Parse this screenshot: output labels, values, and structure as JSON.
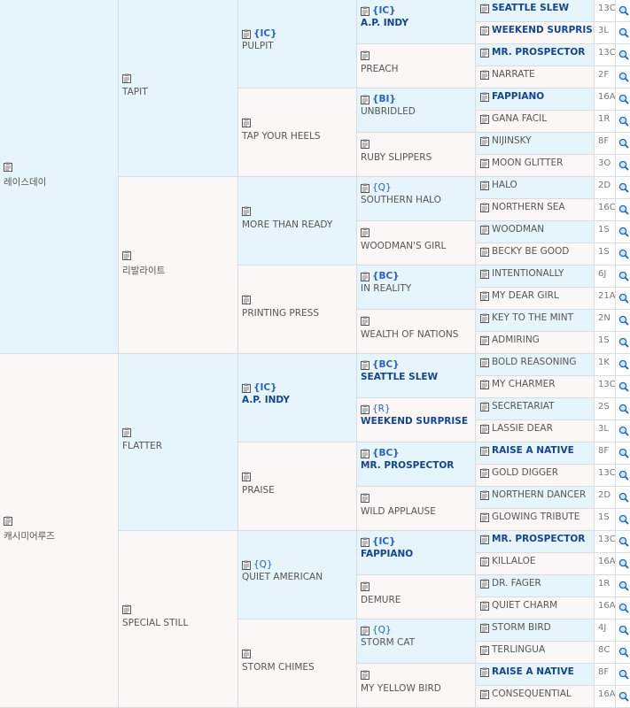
{
  "gen1": [
    {
      "name": "레이스데이",
      "sex": "male"
    },
    {
      "name": "캐시미어루즈",
      "sex": "female"
    }
  ],
  "gen2": [
    {
      "name": "TAPIT",
      "sex": "male"
    },
    {
      "name": "리발라이트",
      "sex": "female"
    },
    {
      "name": "FLATTER",
      "sex": "male"
    },
    {
      "name": "SPECIAL STILL",
      "sex": "female"
    }
  ],
  "gen3": [
    {
      "name": "PULPIT",
      "tag": "{IC}",
      "sex": "male"
    },
    {
      "name": "TAP YOUR HEELS",
      "sex": "female"
    },
    {
      "name": "MORE THAN READY",
      "sex": "male"
    },
    {
      "name": "PRINTING PRESS",
      "sex": "female"
    },
    {
      "name": "A.P. INDY",
      "tag": "{IC}",
      "sex": "male",
      "bold": true
    },
    {
      "name": "PRAISE",
      "sex": "female"
    },
    {
      "name": "QUIET AMERICAN",
      "tag": "{Q}",
      "sex": "male"
    },
    {
      "name": "STORM CHIMES",
      "sex": "female"
    }
  ],
  "gen4": [
    {
      "name": "A.P. INDY",
      "tag": "{IC}",
      "sex": "male",
      "bold": true
    },
    {
      "name": "PREACH",
      "sex": "female"
    },
    {
      "name": "UNBRIDLED",
      "tag": "{BI}",
      "sex": "male"
    },
    {
      "name": "RUBY SLIPPERS",
      "sex": "female"
    },
    {
      "name": "SOUTHERN HALO",
      "tag": "{Q}",
      "sex": "male"
    },
    {
      "name": "WOODMAN'S GIRL",
      "sex": "female"
    },
    {
      "name": "IN REALITY",
      "tag": "{BC}",
      "sex": "male"
    },
    {
      "name": "WEALTH OF NATIONS",
      "sex": "female"
    },
    {
      "name": "SEATTLE SLEW",
      "tag": "{BC}",
      "sex": "male",
      "bold": true
    },
    {
      "name": "WEEKEND SURPRISE",
      "tag": "{R}",
      "sex": "female",
      "bold": true
    },
    {
      "name": "MR. PROSPECTOR",
      "tag": "{BC}",
      "sex": "male",
      "bold": true
    },
    {
      "name": "WILD APPLAUSE",
      "sex": "female"
    },
    {
      "name": "FAPPIANO",
      "tag": "{IC}",
      "sex": "male",
      "bold": true
    },
    {
      "name": "DEMURE",
      "sex": "female"
    },
    {
      "name": "STORM CAT",
      "tag": "{Q}",
      "sex": "male"
    },
    {
      "name": "MY YELLOW BIRD",
      "sex": "female"
    }
  ],
  "gen5": [
    {
      "name": "SEATTLE SLEW",
      "code": "13C",
      "bold": true,
      "sex": "male"
    },
    {
      "name": "WEEKEND SURPRISE",
      "code": "3L",
      "bold": true,
      "sex": "female"
    },
    {
      "name": "MR. PROSPECTOR",
      "code": "13C",
      "bold": true,
      "sex": "male"
    },
    {
      "name": "NARRATE",
      "code": "2F",
      "sex": "female"
    },
    {
      "name": "FAPPIANO",
      "code": "16A",
      "bold": true,
      "sex": "male"
    },
    {
      "name": "GANA FACIL",
      "code": "1R",
      "sex": "female"
    },
    {
      "name": "NIJINSKY",
      "code": "8F",
      "sex": "male"
    },
    {
      "name": "MOON GLITTER",
      "code": "3O",
      "sex": "female"
    },
    {
      "name": "HALO",
      "code": "2D",
      "sex": "male"
    },
    {
      "name": "NORTHERN SEA",
      "code": "16C",
      "sex": "female"
    },
    {
      "name": "WOODMAN",
      "code": "1S",
      "sex": "male"
    },
    {
      "name": "BECKY BE GOOD",
      "code": "1S",
      "sex": "female"
    },
    {
      "name": "INTENTIONALLY",
      "code": "6J",
      "sex": "male"
    },
    {
      "name": "MY DEAR GIRL",
      "code": "21A",
      "sex": "female"
    },
    {
      "name": "KEY TO THE MINT",
      "code": "2N",
      "sex": "male"
    },
    {
      "name": "ADMIRING",
      "code": "1S",
      "sex": "female"
    },
    {
      "name": "BOLD REASONING",
      "code": "1K",
      "sex": "male"
    },
    {
      "name": "MY CHARMER",
      "code": "13C",
      "sex": "female"
    },
    {
      "name": "SECRETARIAT",
      "code": "2S",
      "sex": "male"
    },
    {
      "name": "LASSIE DEAR",
      "code": "3L",
      "sex": "female"
    },
    {
      "name": "RAISE A NATIVE",
      "code": "8F",
      "bold": true,
      "sex": "male"
    },
    {
      "name": "GOLD DIGGER",
      "code": "13C",
      "sex": "female"
    },
    {
      "name": "NORTHERN DANCER",
      "code": "2D",
      "sex": "male"
    },
    {
      "name": "GLOWING TRIBUTE",
      "code": "1S",
      "sex": "female"
    },
    {
      "name": "MR. PROSPECTOR",
      "code": "13C",
      "bold": true,
      "sex": "male"
    },
    {
      "name": "KILLALOE",
      "code": "16A",
      "sex": "female"
    },
    {
      "name": "DR. FAGER",
      "code": "1R",
      "sex": "male"
    },
    {
      "name": "QUIET CHARM",
      "code": "16A",
      "sex": "female"
    },
    {
      "name": "STORM BIRD",
      "code": "4J",
      "sex": "male"
    },
    {
      "name": "TERLINGUA",
      "code": "8C",
      "sex": "female"
    },
    {
      "name": "RAISE A NATIVE",
      "code": "8F",
      "bold": true,
      "sex": "male"
    },
    {
      "name": "CONSEQUENTIAL",
      "code": "16A",
      "sex": "female"
    }
  ],
  "icons": {
    "clipboard": "clipboard-icon",
    "search": "magnifier-icon"
  },
  "colors": {
    "male_bg": "#e6f4fb",
    "female_bg": "#fcf7f7",
    "link": "#14458a",
    "tag": "#2a63b8"
  }
}
